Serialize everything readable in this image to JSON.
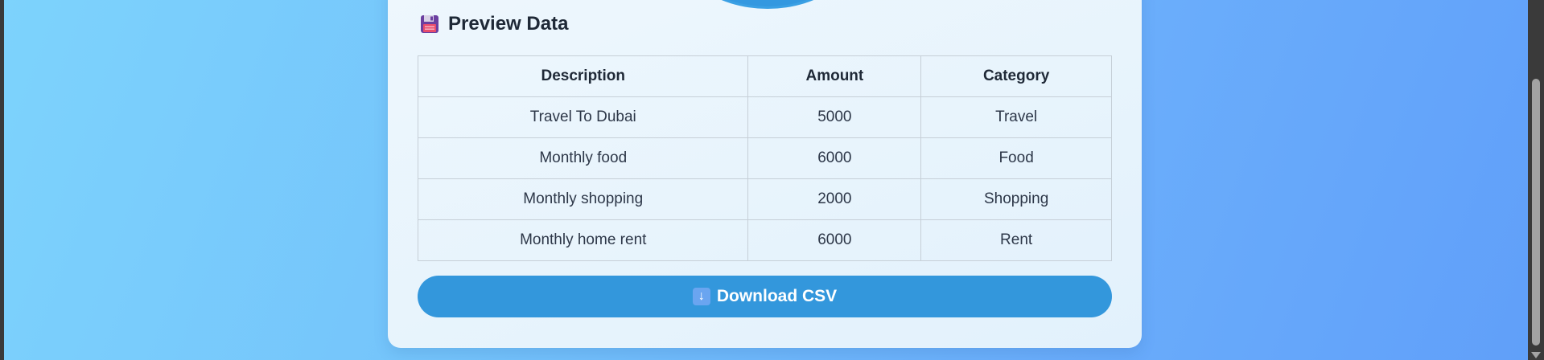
{
  "section": {
    "title": "Preview Data",
    "icon": "floppy-disk-icon"
  },
  "table": {
    "headers": [
      "Description",
      "Amount",
      "Category"
    ],
    "rows": [
      [
        "Travel To Dubai",
        "5000",
        "Travel"
      ],
      [
        "Monthly food",
        "6000",
        "Food"
      ],
      [
        "Monthly shopping",
        "2000",
        "Shopping"
      ],
      [
        "Monthly home rent",
        "6000",
        "Rent"
      ]
    ]
  },
  "download": {
    "label": "Download CSV",
    "icon": "download-arrow-icon",
    "icon_glyph": "↓"
  },
  "colors": {
    "accent": "#3397dc",
    "card_background": "#e6f3fc",
    "page_gradient_start": "#7dd3fc",
    "page_gradient_end": "#609ff9"
  }
}
